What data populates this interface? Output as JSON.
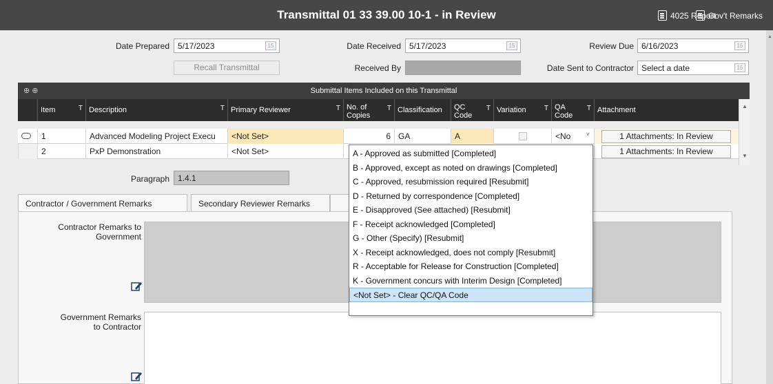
{
  "window": {
    "title": "Transmittal 01 33 39.00 10-1 - in Review",
    "report_button": "4025 Report",
    "remarks_button": "Gov't Remarks"
  },
  "header": {
    "date_prepared_label": "Date Prepared",
    "date_prepared_value": "5/17/2023",
    "date_received_label": "Date Received",
    "date_received_value": "5/17/2023",
    "review_due_label": "Review Due",
    "review_due_value": "6/16/2023",
    "recall_button": "Recall Transmittal",
    "received_by_label": "Received By",
    "received_by_value": "",
    "date_sent_label": "Date Sent to Contractor",
    "date_sent_placeholder": "Select a date",
    "calendar_glyph": "15"
  },
  "grid": {
    "title": "Submittal Items Included on this Transmittal",
    "columns": {
      "item": "Item",
      "description": "Description",
      "primary_reviewer": "Primary Reviewer",
      "copies_line1": "No. of",
      "copies_line2": "Copies",
      "classification": "Classification",
      "qc_line1": "QC",
      "qc_line2": "Code",
      "variation": "Variation",
      "qa_line1": "QA",
      "qa_line2": "Code",
      "attachment": "Attachment"
    },
    "rows": [
      {
        "item": "1",
        "description": "Advanced Modeling Project Execu",
        "primary_reviewer": "<Not Set>",
        "copies": "6",
        "classification": "GA",
        "qc_code": "A",
        "qa_code": "<No",
        "attachment": "1 Attachments: In Review"
      },
      {
        "item": "2",
        "description": "PxP Demonstration",
        "primary_reviewer": "<Not Set>",
        "attachment": "1 Attachments: In Review"
      }
    ]
  },
  "paragraph": {
    "label": "Paragraph",
    "value": "1.4.1"
  },
  "tabs": {
    "tab1": "Contractor / Government Remarks",
    "tab2": "Secondary Reviewer Remarks"
  },
  "remarks": {
    "contractor_line1": "Contractor Remarks to",
    "contractor_line2": "Government",
    "government_line1": "Government Remarks",
    "government_line2": "to Contractor"
  },
  "qa_dropdown": {
    "options": [
      "A - Approved as submitted [Completed]",
      "B - Approved, except as noted on drawings [Completed]",
      "C - Approved, resubmission required [Resubmit]",
      "D - Returned by correspondence [Completed]",
      "E - Disapproved (See attached) [Resubmit]",
      "F - Receipt acknowledged [Completed]",
      "G - Other (Specify) [Resubmit]",
      "X - Receipt acknowledged, does not comply [Resubmit]",
      "R - Acceptable for Release for Construction [Completed]",
      "K - Government concurs with Interim Design [Completed]",
      "<Not Set> - Clear QC/QA Code"
    ],
    "selected_index": 10
  },
  "colors": {
    "titlebar": "#474747",
    "grid_header": "#2c2c2c",
    "highlight_yellow": "#fce7b6",
    "selection_blue": "#cde4f7",
    "remark_readonly": "#cdcdcd"
  }
}
